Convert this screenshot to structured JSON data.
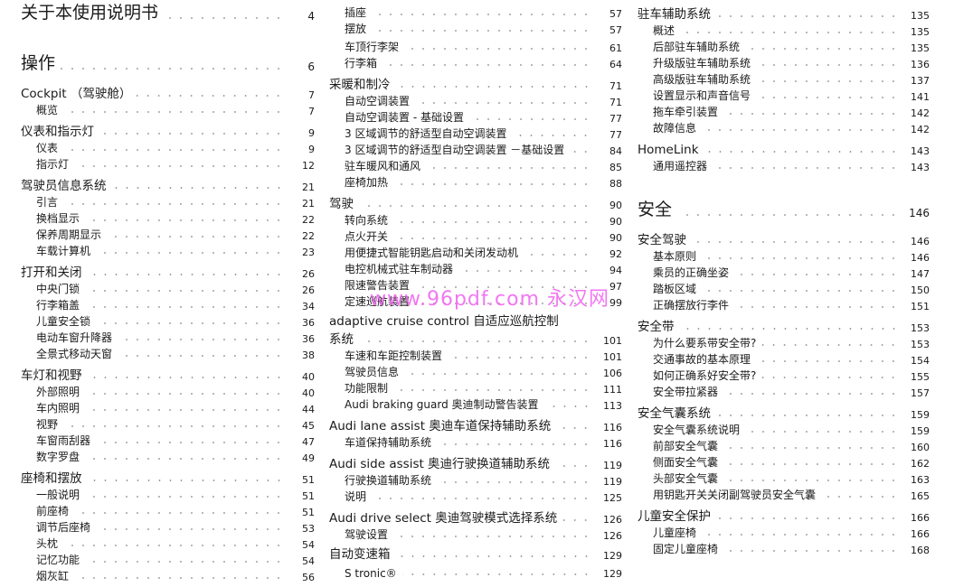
{
  "toc": {
    "columns": [
      {
        "entries": [
          {
            "level": 1,
            "title": "关于本使用说明书",
            "page": "4"
          },
          {
            "level": 1,
            "title": "操作",
            "page": "6"
          },
          {
            "level": 2,
            "title": "Cockpit （驾驶舱）",
            "page": "7"
          },
          {
            "level": 3,
            "title": "概览",
            "page": "7"
          },
          {
            "level": 2,
            "title": "仪表和指示灯",
            "page": "9"
          },
          {
            "level": 3,
            "title": "仪表",
            "page": "9"
          },
          {
            "level": 3,
            "title": "指示灯",
            "page": "12"
          },
          {
            "level": 2,
            "title": "驾驶员信息系统",
            "page": "21"
          },
          {
            "level": 3,
            "title": "引言",
            "page": "21"
          },
          {
            "level": 3,
            "title": "换档显示",
            "page": "22"
          },
          {
            "level": 3,
            "title": "保养周期显示",
            "page": "22"
          },
          {
            "level": 3,
            "title": "车载计算机",
            "page": "23"
          },
          {
            "level": 2,
            "title": "打开和关闭",
            "page": "26"
          },
          {
            "level": 3,
            "title": "中央门锁",
            "page": "26"
          },
          {
            "level": 3,
            "title": "行李箱盖",
            "page": "34"
          },
          {
            "level": 3,
            "title": "儿童安全锁",
            "page": "36"
          },
          {
            "level": 3,
            "title": "电动车窗升降器",
            "page": "36"
          },
          {
            "level": 3,
            "title": "全景式移动天窗",
            "page": "38"
          },
          {
            "level": 2,
            "title": "车灯和视野",
            "page": "40"
          },
          {
            "level": 3,
            "title": "外部照明",
            "page": "40"
          },
          {
            "level": 3,
            "title": "车内照明",
            "page": "44"
          },
          {
            "level": 3,
            "title": "视野",
            "page": "45"
          },
          {
            "level": 3,
            "title": "车窗雨刮器",
            "page": "47"
          },
          {
            "level": 3,
            "title": "数字罗盘",
            "page": "49"
          },
          {
            "level": 2,
            "title": "座椅和摆放",
            "page": "51"
          },
          {
            "level": 3,
            "title": "一般说明",
            "page": "51"
          },
          {
            "level": 3,
            "title": "前座椅",
            "page": "51"
          },
          {
            "level": 3,
            "title": "调节后座椅",
            "page": "53"
          },
          {
            "level": 3,
            "title": "头枕",
            "page": "54"
          },
          {
            "level": 3,
            "title": "记忆功能",
            "page": "54"
          },
          {
            "level": 3,
            "title": "烟灰缸",
            "page": "56"
          }
        ]
      },
      {
        "entries": [
          {
            "level": 3,
            "title": "插座",
            "page": "57"
          },
          {
            "level": 3,
            "title": "摆放",
            "page": "57"
          },
          {
            "level": 3,
            "title": "车顶行李架",
            "page": "61"
          },
          {
            "level": 3,
            "title": "行李箱",
            "page": "64"
          },
          {
            "level": 2,
            "title": "采暖和制冷",
            "page": "71"
          },
          {
            "level": 3,
            "title": "自动空调装置",
            "page": "71"
          },
          {
            "level": 3,
            "title": "自动空调装置 - 基础设置",
            "page": "77"
          },
          {
            "level": 3,
            "title": "3 区域调节的舒适型自动空调装置",
            "page": "77"
          },
          {
            "level": 3,
            "title": "3 区域调节的舒适型自动空调装置 －基础设置",
            "page": "84"
          },
          {
            "level": 3,
            "title": "驻车暖风和通风",
            "page": "85"
          },
          {
            "level": 3,
            "title": "座椅加热",
            "page": "88"
          },
          {
            "level": 2,
            "title": "驾驶",
            "page": "90"
          },
          {
            "level": 3,
            "title": "转向系统",
            "page": "90"
          },
          {
            "level": 3,
            "title": "点火开关",
            "page": "90"
          },
          {
            "level": 3,
            "title": "用便捷式智能钥匙启动和关闭发动机",
            "page": "92"
          },
          {
            "level": 3,
            "title": "电控机械式驻车制动器",
            "page": "94"
          },
          {
            "level": 3,
            "title": "限速警告装置",
            "page": "97"
          },
          {
            "level": 3,
            "title": "定速巡航装置",
            "page": "99"
          },
          {
            "level": 2,
            "title": "adaptive cruise control 自适应巡航控制",
            "page": "",
            "nodots": true
          },
          {
            "level": 2,
            "title": "系统",
            "page": "101"
          },
          {
            "level": 3,
            "title": "车速和车距控制装置",
            "page": "101"
          },
          {
            "level": 3,
            "title": "驾驶员信息",
            "page": "106"
          },
          {
            "level": 3,
            "title": "功能限制",
            "page": "111"
          },
          {
            "level": 3,
            "title": "Audi braking guard 奥迪制动警告装置",
            "page": "113"
          },
          {
            "level": 2,
            "title": "Audi lane assist 奥迪车道保持辅助系统",
            "page": "116"
          },
          {
            "level": 3,
            "title": "车道保持辅助系统",
            "page": "116"
          },
          {
            "level": 2,
            "title": "Audi side assist 奥迪行驶换道辅助系统",
            "page": "119"
          },
          {
            "level": 3,
            "title": "行驶换道辅助系统",
            "page": "119"
          },
          {
            "level": 3,
            "title": "说明",
            "page": "125"
          },
          {
            "level": 2,
            "title": "Audi drive select 奥迪驾驶模式选择系统",
            "page": "126"
          },
          {
            "level": 3,
            "title": "驾驶设置",
            "page": "126"
          },
          {
            "level": 2,
            "title": "自动变速箱",
            "page": "129"
          },
          {
            "level": 3,
            "title": "S tronic®",
            "page": "129"
          }
        ]
      },
      {
        "entries": [
          {
            "level": 2,
            "title": "驻车辅助系统",
            "page": "135"
          },
          {
            "level": 3,
            "title": "概述",
            "page": "135"
          },
          {
            "level": 3,
            "title": "后部驻车辅助系统",
            "page": "135"
          },
          {
            "level": 3,
            "title": "升级版驻车辅助系统",
            "page": "136"
          },
          {
            "level": 3,
            "title": "高级版驻车辅助系统",
            "page": "137"
          },
          {
            "level": 3,
            "title": "设置显示和声音信号",
            "page": "141"
          },
          {
            "level": 3,
            "title": "拖车牵引装置",
            "page": "142"
          },
          {
            "level": 3,
            "title": "故障信息",
            "page": "142"
          },
          {
            "level": 2,
            "title": "HomeLink",
            "page": "143"
          },
          {
            "level": 3,
            "title": "通用遥控器",
            "page": "143"
          },
          {
            "level": 1,
            "title": "安全",
            "page": "146"
          },
          {
            "level": 2,
            "title": "安全驾驶",
            "page": "146"
          },
          {
            "level": 3,
            "title": "基本原则",
            "page": "146"
          },
          {
            "level": 3,
            "title": "乘员的正确坐姿",
            "page": "147"
          },
          {
            "level": 3,
            "title": "踏板区域",
            "page": "150"
          },
          {
            "level": 3,
            "title": "正确摆放行李件",
            "page": "151"
          },
          {
            "level": 2,
            "title": "安全带",
            "page": "153"
          },
          {
            "level": 3,
            "title": "为什么要系带安全带?",
            "page": "153"
          },
          {
            "level": 3,
            "title": "交通事故的基本原理",
            "page": "154"
          },
          {
            "level": 3,
            "title": "如何正确系好安全带?",
            "page": "155"
          },
          {
            "level": 3,
            "title": "安全带拉紧器",
            "page": "157"
          },
          {
            "level": 2,
            "title": "安全气囊系统",
            "page": "159"
          },
          {
            "level": 3,
            "title": "安全气囊系统说明",
            "page": "159"
          },
          {
            "level": 3,
            "title": "前部安全气囊",
            "page": "160"
          },
          {
            "level": 3,
            "title": "侧面安全气囊",
            "page": "162"
          },
          {
            "level": 3,
            "title": "头部安全气囊",
            "page": "163"
          },
          {
            "level": 3,
            "title": "用钥匙开关关闭副驾驶员安全气囊",
            "page": "165"
          },
          {
            "level": 2,
            "title": "儿童安全保护",
            "page": "166"
          },
          {
            "level": 3,
            "title": "儿童座椅",
            "page": "166"
          },
          {
            "level": 3,
            "title": "固定儿童座椅",
            "page": "168"
          }
        ]
      }
    ]
  },
  "watermark": "www.96pdf.com 永汉网"
}
